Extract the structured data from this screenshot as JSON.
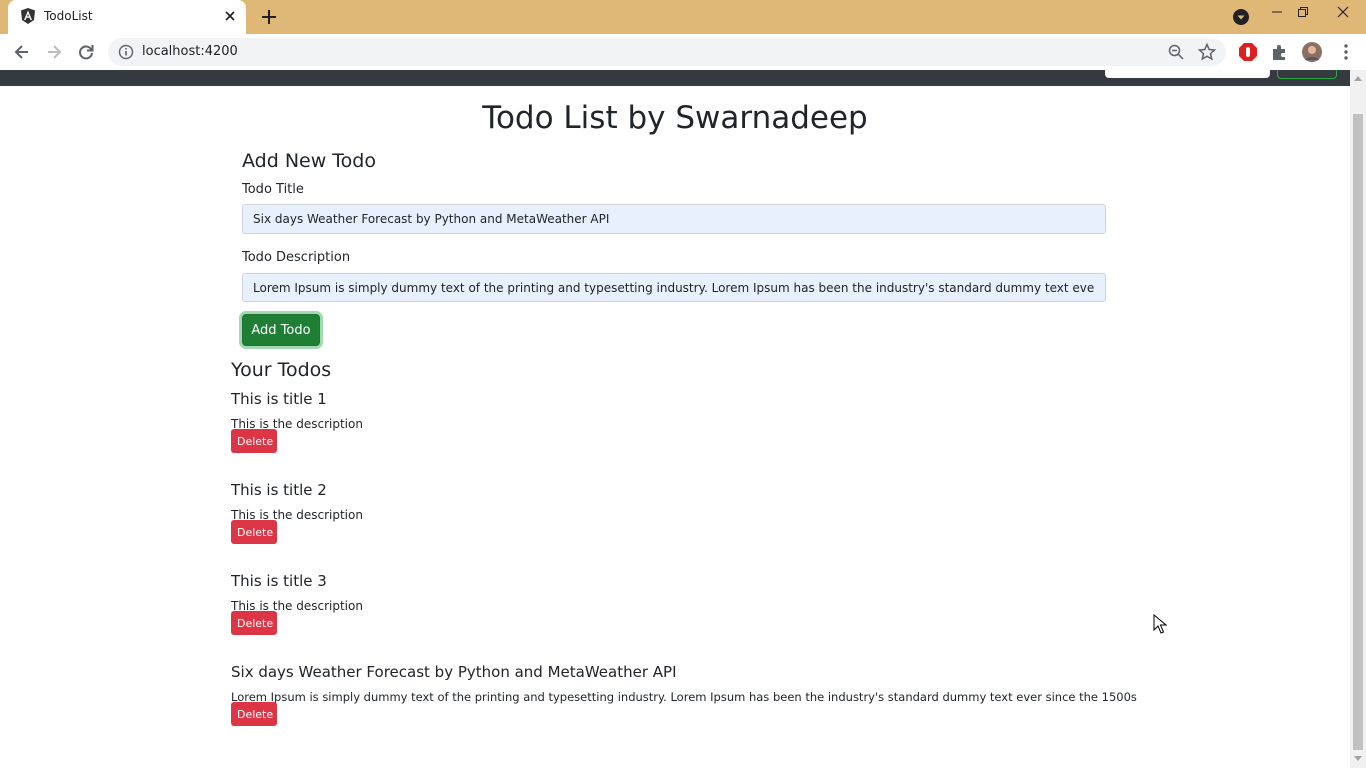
{
  "browser": {
    "tab_title": "TodoList",
    "url": "localhost:4200"
  },
  "page": {
    "title": "Todo List by Swarnadeep",
    "add_heading": "Add New Todo",
    "title_label": "Todo Title",
    "title_value": "Six days Weather Forecast by Python and MetaWeather API",
    "desc_label": "Todo Description",
    "desc_value": "Lorem Ipsum is simply dummy text of the printing and typesetting industry. Lorem Ipsum has been the industry's standard dummy text ever since the 1500s",
    "add_button": "Add Todo",
    "todos_heading": "Your Todos",
    "delete_label": "Delete",
    "todos": [
      {
        "title": "This is title 1",
        "desc": "This is the description"
      },
      {
        "title": "This is title 2",
        "desc": "This is the description"
      },
      {
        "title": "This is title 3",
        "desc": "This is the description"
      },
      {
        "title": "Six days Weather Forecast by Python and MetaWeather API",
        "desc": "Lorem Ipsum is simply dummy text of the printing and typesetting industry. Lorem Ipsum has been the industry's standard dummy text ever since the 1500s"
      }
    ]
  },
  "colors": {
    "tabbar": "#dfb878",
    "navbar": "#343a40",
    "add_button": "#1e7e34",
    "delete_button": "#dc3545",
    "input_autofill": "#e8f0fe"
  }
}
